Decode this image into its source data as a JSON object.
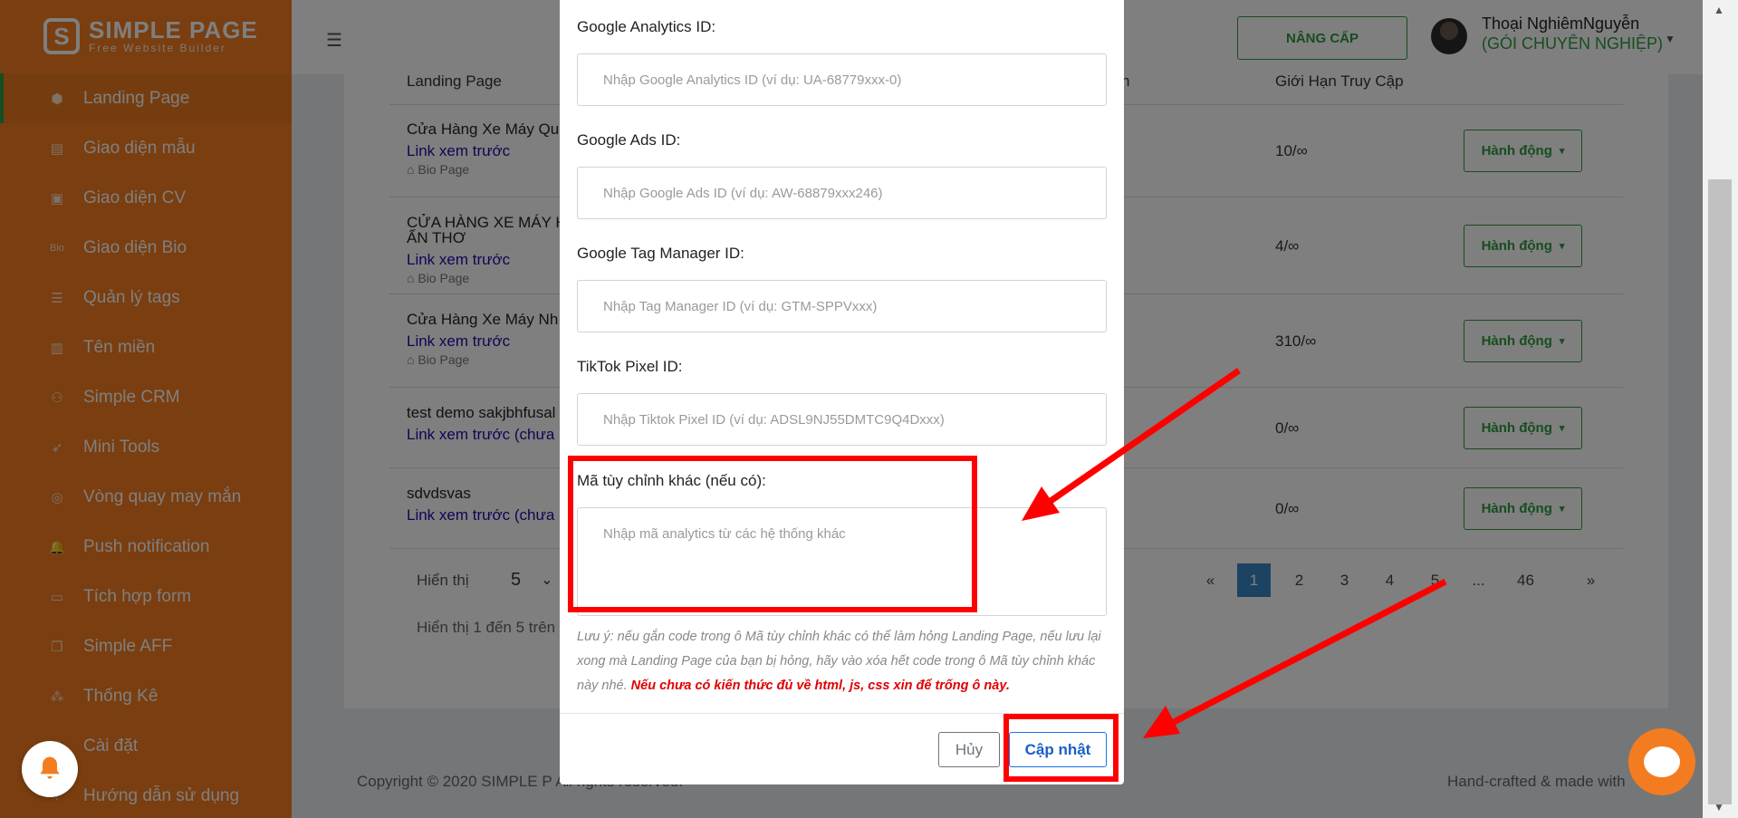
{
  "brand": {
    "title": "SIMPLE PAGE",
    "subtitle": "Free Website Builder"
  },
  "sidebar": {
    "items": [
      {
        "label": "Landing Page",
        "icon": "cube-icon",
        "active": true
      },
      {
        "label": "Giao diện mẫu",
        "icon": "template-icon"
      },
      {
        "label": "Giao diện CV",
        "icon": "cv-icon"
      },
      {
        "label": "Giao diện Bio",
        "icon": "bio-icon"
      },
      {
        "label": "Quản lý tags",
        "icon": "list-icon"
      },
      {
        "label": "Tên miền",
        "icon": "chart-icon"
      },
      {
        "label": "Simple CRM",
        "icon": "users-icon"
      },
      {
        "label": "Mini Tools",
        "icon": "rocket-icon"
      },
      {
        "label": "Vòng quay may mắn",
        "icon": "wheel-icon"
      },
      {
        "label": "Push notification",
        "icon": "bell-icon"
      },
      {
        "label": "Tích hợp form",
        "icon": "form-icon"
      },
      {
        "label": "Simple AFF",
        "icon": "copy-icon"
      },
      {
        "label": "Thống Kê",
        "icon": "stats-icon"
      },
      {
        "label": "Cài đặt",
        "icon": "gear-icon"
      },
      {
        "label": "Hướng dẫn sử dụng",
        "icon": "help-icon"
      }
    ]
  },
  "header": {
    "upgrade_label": "NÂNG CẤP",
    "user_name": "Thoại NghiêmNguyễn",
    "user_plan": "(GÓI CHUYÊN NGHIỆP)"
  },
  "table": {
    "col_landing": "Landing Page",
    "col_fragment": "n",
    "col_limit": "Giới Hạn Truy Cập",
    "rows": [
      {
        "title": "Cửa Hàng Xe Máy Qu",
        "link": "Link xem trước",
        "tag": "Bio Page",
        "limit": "10/∞",
        "action": "Hành động"
      },
      {
        "title": "CỬA HÀNG XE MÁY H",
        "title2": "ẤN THƠ",
        "link": "Link xem trước",
        "tag": "Bio Page",
        "limit": "4/∞",
        "action": "Hành động"
      },
      {
        "title": "Cửa Hàng Xe Máy Nh",
        "link": "Link xem trước",
        "tag": "Bio Page",
        "limit": "310/∞",
        "action": "Hành động"
      },
      {
        "title": "test demo sakjbhfusal",
        "link": "Link xem trước (chưa :",
        "limit": "0/∞",
        "action": "Hành động"
      },
      {
        "title": "sdvdsvas",
        "link": "Link xem trước (chưa",
        "limit": "0/∞",
        "action": "Hành động"
      }
    ],
    "per_page_label": "Hiển thị",
    "per_page_value": "5",
    "show_info": "Hiển thị 1 đến 5 trên",
    "pagination": [
      "«",
      "1",
      "2",
      "3",
      "4",
      "5",
      "...",
      "46",
      "»"
    ],
    "current_page": "1"
  },
  "footer": {
    "left": "Copyright © 2020 SIMPLE P",
    "left_tail": "All rights reserved.",
    "right": "Hand-crafted & made with"
  },
  "modal": {
    "ga_label": "Google Analytics ID:",
    "ga_placeholder": "Nhập Google Analytics ID (ví dụ: UA-68779xxx-0)",
    "ads_label": "Google Ads ID:",
    "ads_placeholder": "Nhập Google Ads ID (ví dụ: AW-68879xxx246)",
    "gtm_label": "Google Tag Manager ID:",
    "gtm_placeholder": "Nhập Tag Manager ID (ví dụ: GTM-SPPVxxx)",
    "tiktok_label": "TikTok Pixel ID:",
    "tiktok_placeholder": "Nhập Tiktok Pixel ID (ví dụ: ADSL9NJ55DMTC9Q4Dxxx)",
    "custom_label": "Mã tùy chỉnh khác (nếu có):",
    "custom_placeholder": "Nhập mã analytics từ các hệ thống khác",
    "note": "Lưu ý: nếu gắn code trong ô Mã tùy chỉnh khác có thể làm hỏng Landing Page, nếu lưu lại xong mà Landing Page của bạn bị hỏng, hãy vào xóa hết code trong ô Mã tùy chỉnh khác này nhé.",
    "note_warning": "Nếu chưa có kiến thức đủ về html, js, css xin để trống ô này.",
    "cancel_label": "Hủy",
    "update_label": "Cập nhật"
  },
  "colors": {
    "sidebar": "#f47c20",
    "accent_green": "#2e9a3f",
    "annotation_red": "#ff0000",
    "link_blue": "#1a0dab"
  }
}
